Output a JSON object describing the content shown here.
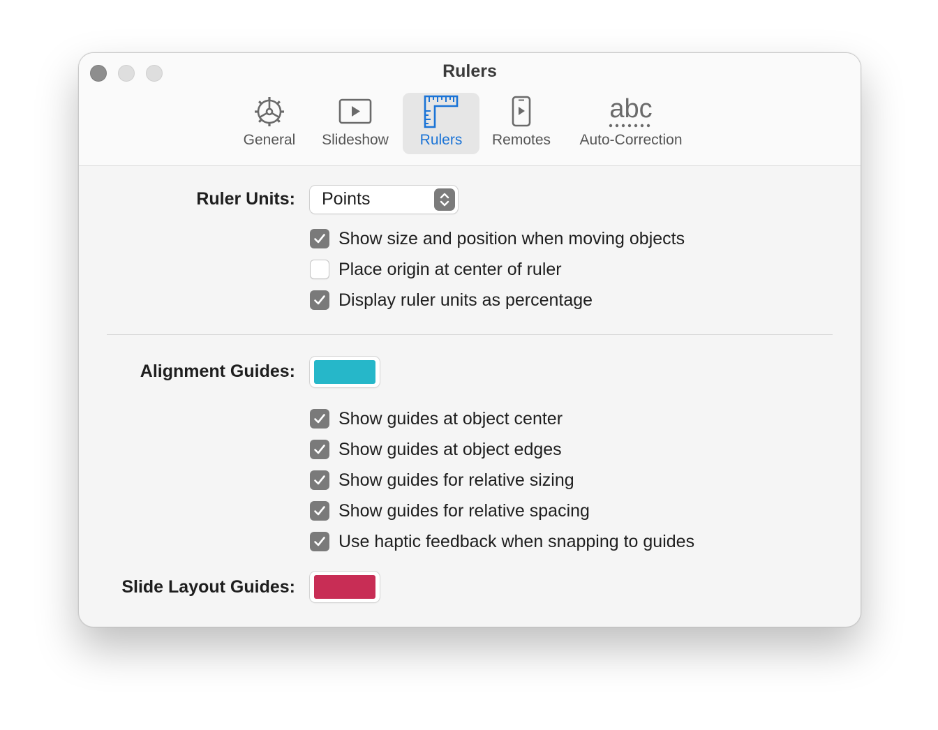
{
  "window": {
    "title": "Rulers"
  },
  "toolbar": {
    "items": [
      {
        "label": "General",
        "icon": "gear-icon",
        "selected": false
      },
      {
        "label": "Slideshow",
        "icon": "play-icon",
        "selected": false
      },
      {
        "label": "Rulers",
        "icon": "ruler-icon",
        "selected": true
      },
      {
        "label": "Remotes",
        "icon": "remote-device-icon",
        "selected": false
      },
      {
        "label": "Auto-Correction",
        "icon": "abc-icon",
        "selected": false
      }
    ],
    "abc_glyph": "abc"
  },
  "ruler_units": {
    "label": "Ruler Units:",
    "value": "Points",
    "options": [
      {
        "label": "Show size and position when moving objects",
        "checked": true
      },
      {
        "label": "Place origin at center of ruler",
        "checked": false
      },
      {
        "label": "Display ruler units as percentage",
        "checked": true
      }
    ]
  },
  "alignment_guides": {
    "label": "Alignment Guides:",
    "color": "#26b7c9",
    "options": [
      {
        "label": "Show guides at object center",
        "checked": true
      },
      {
        "label": "Show guides at object edges",
        "checked": true
      },
      {
        "label": "Show guides for relative sizing",
        "checked": true
      },
      {
        "label": "Show guides for relative spacing",
        "checked": true
      },
      {
        "label": "Use haptic feedback when snapping to guides",
        "checked": true
      }
    ]
  },
  "slide_layout_guides": {
    "label": "Slide Layout Guides:",
    "color": "#c82d55"
  },
  "colors": {
    "accent": "#1a73d6",
    "checkbox_on": "#7a7a7a"
  }
}
